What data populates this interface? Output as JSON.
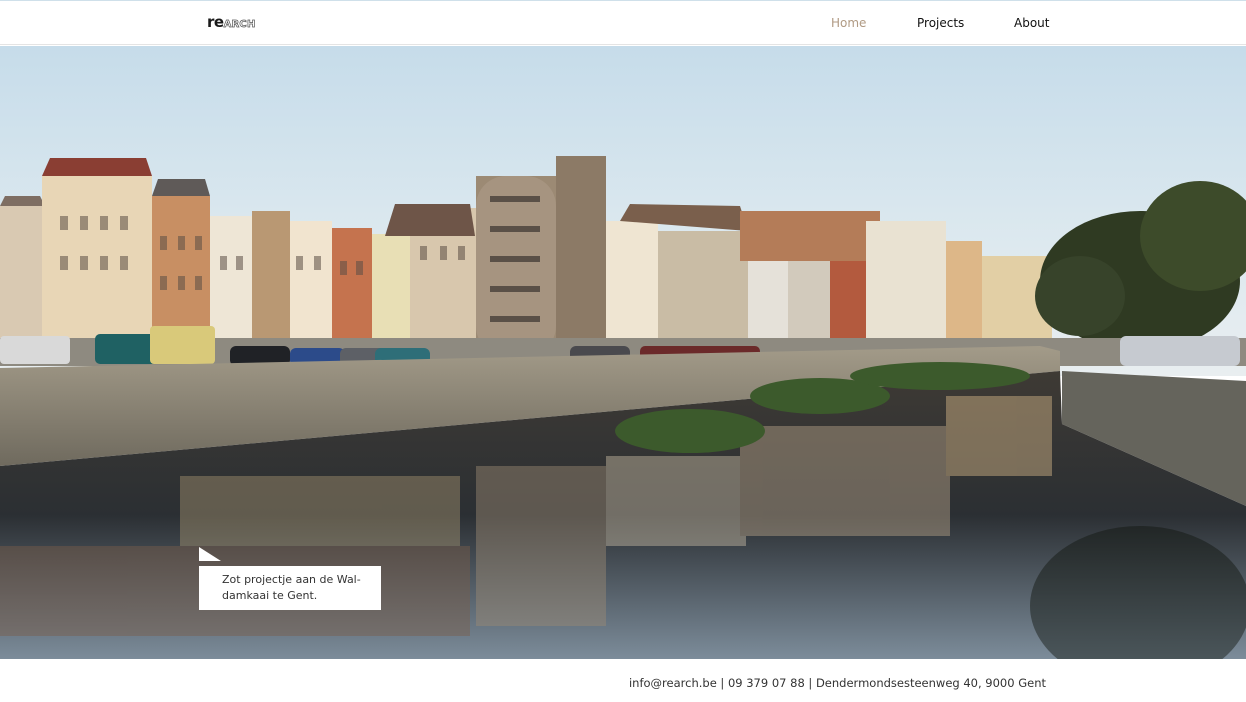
{
  "header": {
    "logo": {
      "part1": "re",
      "part2": "ARCH"
    },
    "nav": [
      {
        "label": "Home",
        "active": true
      },
      {
        "label": "Projects",
        "active": false
      },
      {
        "label": "About",
        "active": false
      }
    ]
  },
  "hero": {
    "caption": "Zot projectje aan de Wal-damkaai te Gent."
  },
  "footer": {
    "contact": "info@rearch.be | 09 379 07 88 | Dendermondsesteenweg 40, 9000 Gent"
  },
  "colors": {
    "nav_active": "#b09a83",
    "text": "#222222"
  }
}
